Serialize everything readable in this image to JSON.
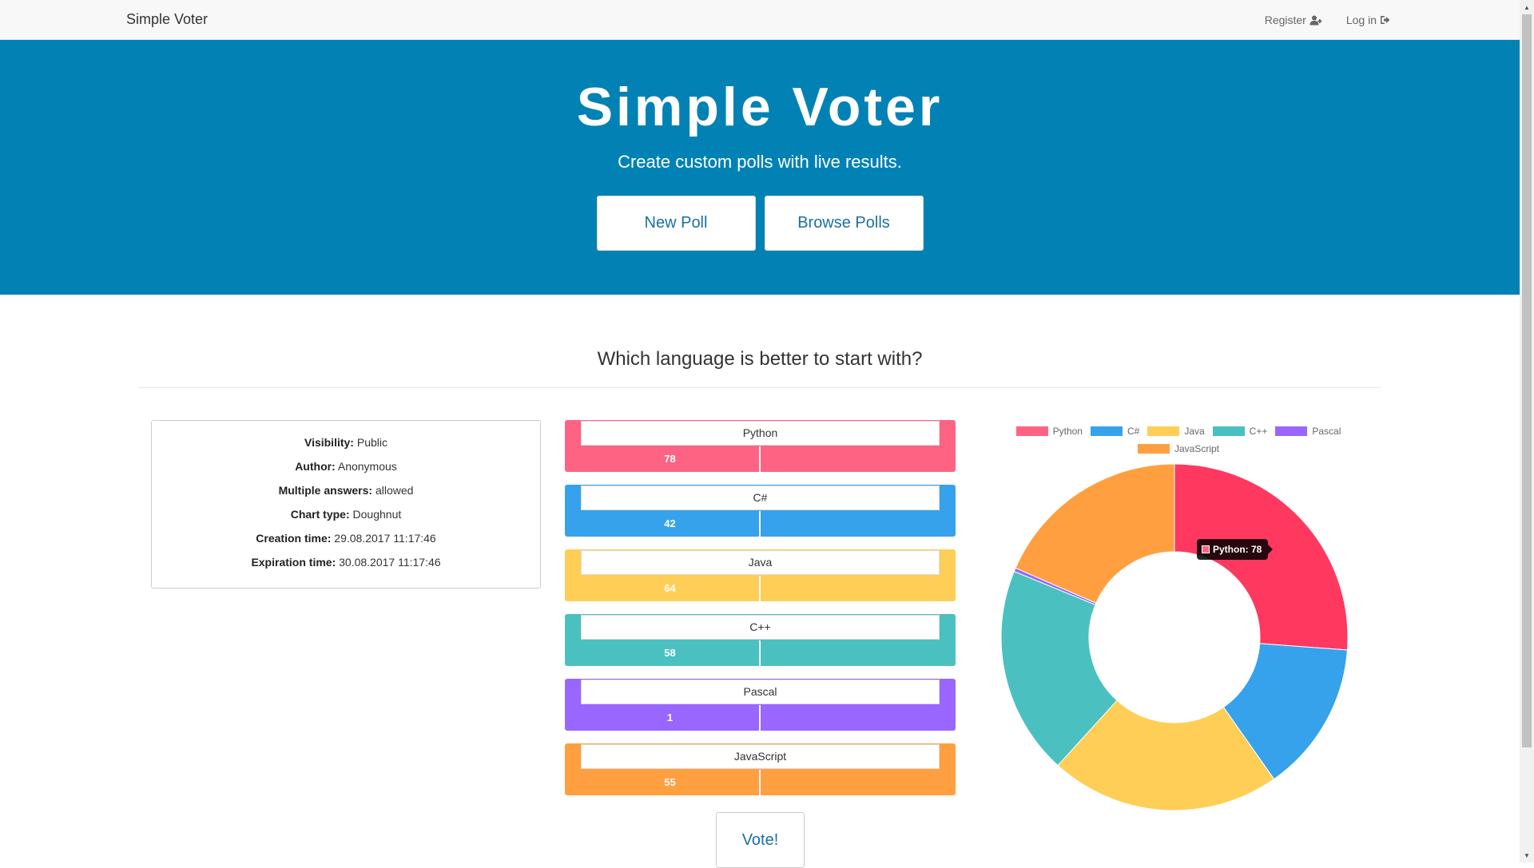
{
  "navbar": {
    "brand": "Simple Voter",
    "links": [
      {
        "label": "Register",
        "icon": "user-plus-icon"
      },
      {
        "label": "Log in",
        "icon": "sign-in-icon"
      }
    ]
  },
  "hero": {
    "title": "Simple Voter",
    "lead": "Create custom polls with live results.",
    "buttons": [
      "New Poll",
      "Browse Polls"
    ]
  },
  "poll": {
    "question": "Which language is better to start with?",
    "info": [
      {
        "key": "Visibility:",
        "value": "Public"
      },
      {
        "key": "Author:",
        "value": "Anonymous"
      },
      {
        "key": "Multiple answers:",
        "value": "allowed"
      },
      {
        "key": "Chart type:",
        "value": "Doughnut"
      },
      {
        "key": "Creation time:",
        "value": "29.08.2017 11:17:46"
      },
      {
        "key": "Expiration time:",
        "value": "30.08.2017 11:17:46"
      }
    ],
    "options": [
      {
        "label": "Python",
        "count": "78",
        "color": "#ff6384"
      },
      {
        "label": "C#",
        "count": "42",
        "color": "#36a2eb"
      },
      {
        "label": "Java",
        "count": "64",
        "color": "#ffce56"
      },
      {
        "label": "C++",
        "count": "58",
        "color": "#4bc0c0"
      },
      {
        "label": "Pascal",
        "count": "1",
        "color": "#9966ff"
      },
      {
        "label": "JavaScript",
        "count": "55",
        "color": "#ff9f40"
      }
    ],
    "vote_label": "Vote!"
  },
  "tooltip": {
    "text": "Python: 78",
    "color": "#ff6384"
  },
  "chart_data": {
    "type": "doughnut",
    "categories": [
      "Python",
      "C#",
      "Java",
      "C++",
      "Pascal",
      "JavaScript"
    ],
    "values": [
      78,
      42,
      64,
      58,
      1,
      55
    ],
    "colors": [
      "#ff3860",
      "#36a2eb",
      "#ffce56",
      "#4bc0c0",
      "#9966ff",
      "#ff9f40"
    ],
    "legend": "top",
    "title": ""
  }
}
